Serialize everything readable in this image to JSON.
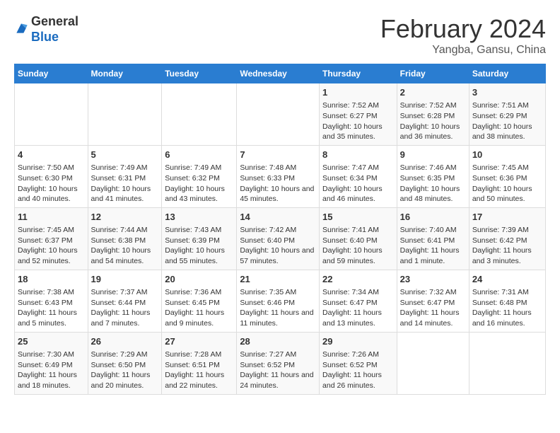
{
  "logo": {
    "general": "General",
    "blue": "Blue"
  },
  "title": "February 2024",
  "location": "Yangba, Gansu, China",
  "weekdays": [
    "Sunday",
    "Monday",
    "Tuesday",
    "Wednesday",
    "Thursday",
    "Friday",
    "Saturday"
  ],
  "weeks": [
    [
      {
        "day": "",
        "info": ""
      },
      {
        "day": "",
        "info": ""
      },
      {
        "day": "",
        "info": ""
      },
      {
        "day": "",
        "info": ""
      },
      {
        "day": "1",
        "info": "Sunrise: 7:52 AM\nSunset: 6:27 PM\nDaylight: 10 hours and 35 minutes."
      },
      {
        "day": "2",
        "info": "Sunrise: 7:52 AM\nSunset: 6:28 PM\nDaylight: 10 hours and 36 minutes."
      },
      {
        "day": "3",
        "info": "Sunrise: 7:51 AM\nSunset: 6:29 PM\nDaylight: 10 hours and 38 minutes."
      }
    ],
    [
      {
        "day": "4",
        "info": "Sunrise: 7:50 AM\nSunset: 6:30 PM\nDaylight: 10 hours and 40 minutes."
      },
      {
        "day": "5",
        "info": "Sunrise: 7:49 AM\nSunset: 6:31 PM\nDaylight: 10 hours and 41 minutes."
      },
      {
        "day": "6",
        "info": "Sunrise: 7:49 AM\nSunset: 6:32 PM\nDaylight: 10 hours and 43 minutes."
      },
      {
        "day": "7",
        "info": "Sunrise: 7:48 AM\nSunset: 6:33 PM\nDaylight: 10 hours and 45 minutes."
      },
      {
        "day": "8",
        "info": "Sunrise: 7:47 AM\nSunset: 6:34 PM\nDaylight: 10 hours and 46 minutes."
      },
      {
        "day": "9",
        "info": "Sunrise: 7:46 AM\nSunset: 6:35 PM\nDaylight: 10 hours and 48 minutes."
      },
      {
        "day": "10",
        "info": "Sunrise: 7:45 AM\nSunset: 6:36 PM\nDaylight: 10 hours and 50 minutes."
      }
    ],
    [
      {
        "day": "11",
        "info": "Sunrise: 7:45 AM\nSunset: 6:37 PM\nDaylight: 10 hours and 52 minutes."
      },
      {
        "day": "12",
        "info": "Sunrise: 7:44 AM\nSunset: 6:38 PM\nDaylight: 10 hours and 54 minutes."
      },
      {
        "day": "13",
        "info": "Sunrise: 7:43 AM\nSunset: 6:39 PM\nDaylight: 10 hours and 55 minutes."
      },
      {
        "day": "14",
        "info": "Sunrise: 7:42 AM\nSunset: 6:40 PM\nDaylight: 10 hours and 57 minutes."
      },
      {
        "day": "15",
        "info": "Sunrise: 7:41 AM\nSunset: 6:40 PM\nDaylight: 10 hours and 59 minutes."
      },
      {
        "day": "16",
        "info": "Sunrise: 7:40 AM\nSunset: 6:41 PM\nDaylight: 11 hours and 1 minute."
      },
      {
        "day": "17",
        "info": "Sunrise: 7:39 AM\nSunset: 6:42 PM\nDaylight: 11 hours and 3 minutes."
      }
    ],
    [
      {
        "day": "18",
        "info": "Sunrise: 7:38 AM\nSunset: 6:43 PM\nDaylight: 11 hours and 5 minutes."
      },
      {
        "day": "19",
        "info": "Sunrise: 7:37 AM\nSunset: 6:44 PM\nDaylight: 11 hours and 7 minutes."
      },
      {
        "day": "20",
        "info": "Sunrise: 7:36 AM\nSunset: 6:45 PM\nDaylight: 11 hours and 9 minutes."
      },
      {
        "day": "21",
        "info": "Sunrise: 7:35 AM\nSunset: 6:46 PM\nDaylight: 11 hours and 11 minutes."
      },
      {
        "day": "22",
        "info": "Sunrise: 7:34 AM\nSunset: 6:47 PM\nDaylight: 11 hours and 13 minutes."
      },
      {
        "day": "23",
        "info": "Sunrise: 7:32 AM\nSunset: 6:47 PM\nDaylight: 11 hours and 14 minutes."
      },
      {
        "day": "24",
        "info": "Sunrise: 7:31 AM\nSunset: 6:48 PM\nDaylight: 11 hours and 16 minutes."
      }
    ],
    [
      {
        "day": "25",
        "info": "Sunrise: 7:30 AM\nSunset: 6:49 PM\nDaylight: 11 hours and 18 minutes."
      },
      {
        "day": "26",
        "info": "Sunrise: 7:29 AM\nSunset: 6:50 PM\nDaylight: 11 hours and 20 minutes."
      },
      {
        "day": "27",
        "info": "Sunrise: 7:28 AM\nSunset: 6:51 PM\nDaylight: 11 hours and 22 minutes."
      },
      {
        "day": "28",
        "info": "Sunrise: 7:27 AM\nSunset: 6:52 PM\nDaylight: 11 hours and 24 minutes."
      },
      {
        "day": "29",
        "info": "Sunrise: 7:26 AM\nSunset: 6:52 PM\nDaylight: 11 hours and 26 minutes."
      },
      {
        "day": "",
        "info": ""
      },
      {
        "day": "",
        "info": ""
      }
    ]
  ]
}
